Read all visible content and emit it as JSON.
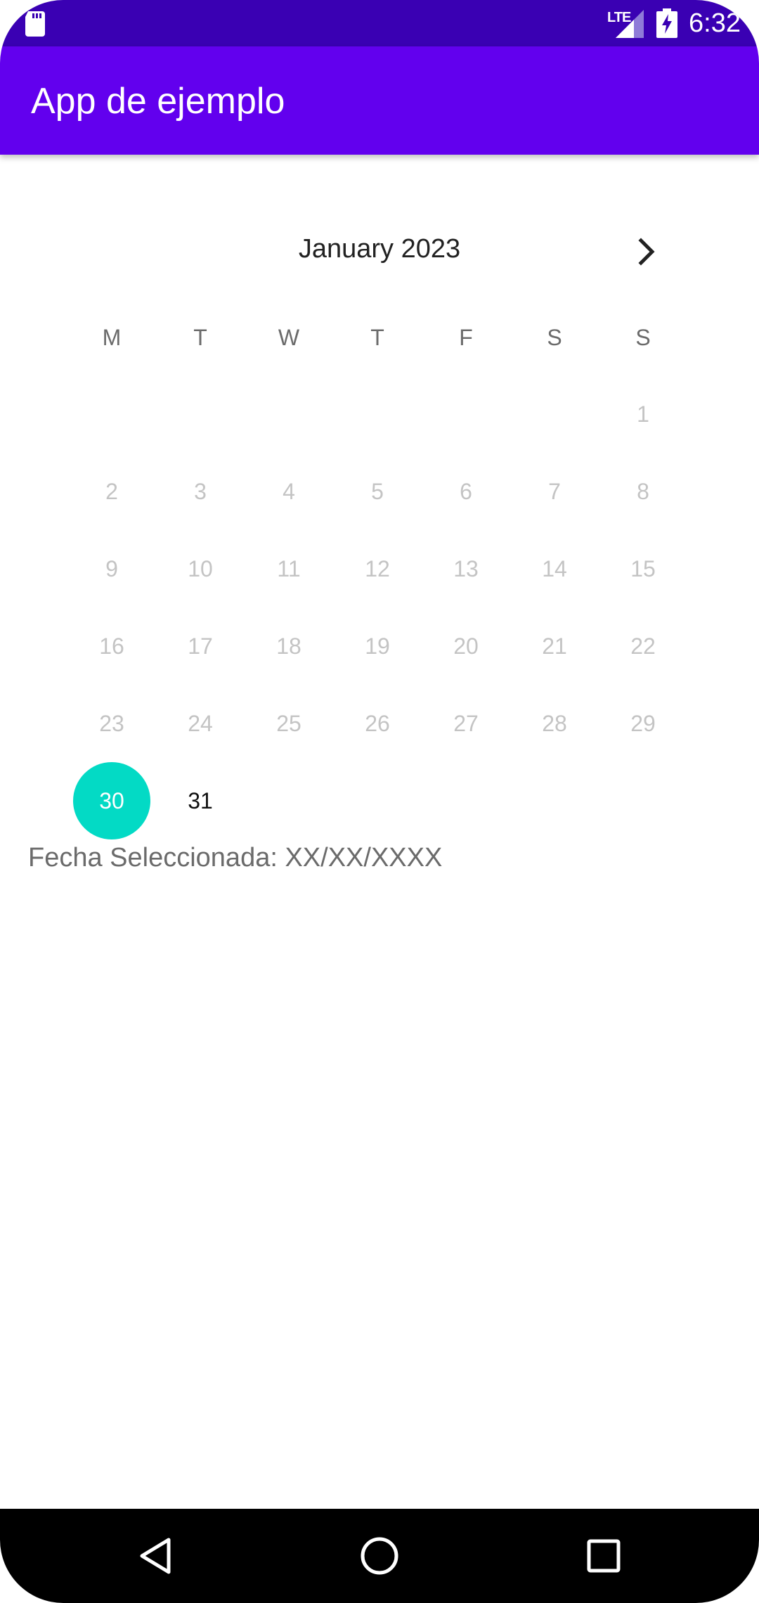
{
  "status_bar": {
    "network": "LTE",
    "time": "6:32",
    "icons": [
      "sd-card-icon",
      "signal-icon",
      "battery-charging-icon"
    ]
  },
  "app_bar": {
    "title": "App de ejemplo"
  },
  "calendar": {
    "month_label": "January 2023",
    "next_icon": "chevron-right-icon",
    "weekdays": [
      "M",
      "T",
      "W",
      "T",
      "F",
      "S",
      "S"
    ],
    "leading_blanks": 6,
    "days": [
      "1",
      "2",
      "3",
      "4",
      "5",
      "6",
      "7",
      "8",
      "9",
      "10",
      "11",
      "12",
      "13",
      "14",
      "15",
      "16",
      "17",
      "18",
      "19",
      "20",
      "21",
      "22",
      "23",
      "24",
      "25",
      "26",
      "27",
      "28",
      "29",
      "30",
      "31"
    ],
    "selected_day": "30",
    "enabled_days": [
      "30",
      "31"
    ],
    "selected_color": "#03dac5"
  },
  "selected_date_text": "Fecha Seleccionada: XX/XX/XXXX",
  "nav_bar": {
    "icons": [
      "back-icon",
      "home-icon",
      "recents-icon"
    ]
  },
  "colors": {
    "primary": "#6200ee",
    "primary_dark": "#3a00b3",
    "accent": "#03dac5"
  }
}
